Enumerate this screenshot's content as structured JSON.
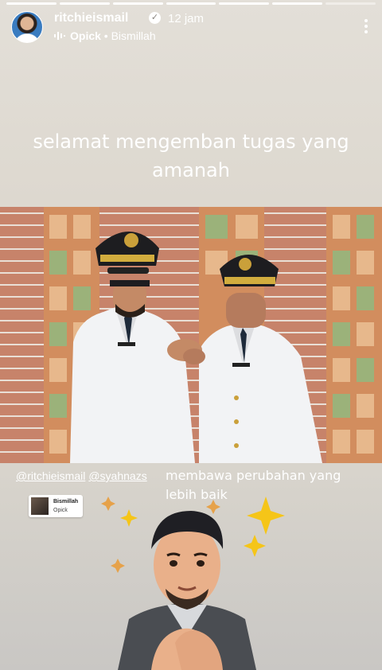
{
  "story": {
    "progress_total": 7,
    "progress_current": 6
  },
  "header": {
    "username": "ritchieismail",
    "verified_icon": "verified-badge-icon",
    "time": "12 jam",
    "music_icon": "sound-wave-icon",
    "music_title": "Opick",
    "music_separator": " • ",
    "music_song": "Bismillah",
    "more_icon": "more-vertical-icon"
  },
  "caption": {
    "line1": "selamat mengemban tugas yang",
    "line2": "amanah"
  },
  "mentions": [
    "@ritchieismail",
    "@syahnazs"
  ],
  "caption2": "membawa perubahan yang lebih baik",
  "music_sticker": {
    "title": "Bismillah",
    "artist": "Opick"
  },
  "colors": {
    "background_top": "#e3dfd8",
    "background_bottom": "#c9c7c4",
    "brick": "#c7836a",
    "uniform": "#f2f3f5",
    "hat": "#1d1d20",
    "sparkle": "#f5c518"
  }
}
